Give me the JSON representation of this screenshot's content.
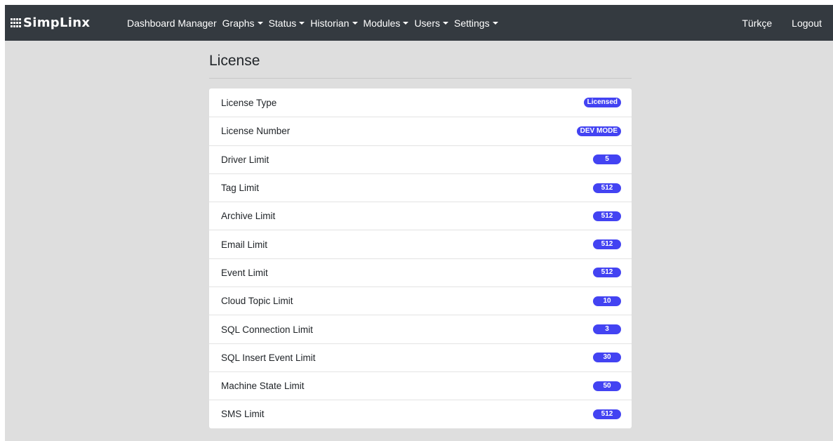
{
  "navbar": {
    "brand": "SimpLinx",
    "links": [
      {
        "label": "Dashboard Manager",
        "dropdown": false
      },
      {
        "label": "Graphs",
        "dropdown": true
      },
      {
        "label": "Status",
        "dropdown": true
      },
      {
        "label": "Historian",
        "dropdown": true
      },
      {
        "label": "Modules",
        "dropdown": true
      },
      {
        "label": "Users",
        "dropdown": true
      },
      {
        "label": "Settings",
        "dropdown": true
      }
    ],
    "language": "Türkçe",
    "logout": "Logout"
  },
  "page": {
    "title": "License"
  },
  "license_rows": [
    {
      "label": "License Type",
      "value": "Licensed"
    },
    {
      "label": "License Number",
      "value": "DEV MODE"
    },
    {
      "label": "Driver Limit",
      "value": "5"
    },
    {
      "label": "Tag Limit",
      "value": "512"
    },
    {
      "label": "Archive Limit",
      "value": "512"
    },
    {
      "label": "Email Limit",
      "value": "512"
    },
    {
      "label": "Event Limit",
      "value": "512"
    },
    {
      "label": "Cloud Topic Limit",
      "value": "10"
    },
    {
      "label": "SQL Connection Limit",
      "value": "3"
    },
    {
      "label": "SQL Insert Event Limit",
      "value": "30"
    },
    {
      "label": "Machine State Limit",
      "value": "50"
    },
    {
      "label": "SMS Limit",
      "value": "512"
    }
  ],
  "colors": {
    "navbar": "#343a40",
    "background": "#dedede",
    "badge": "#4343f2"
  }
}
